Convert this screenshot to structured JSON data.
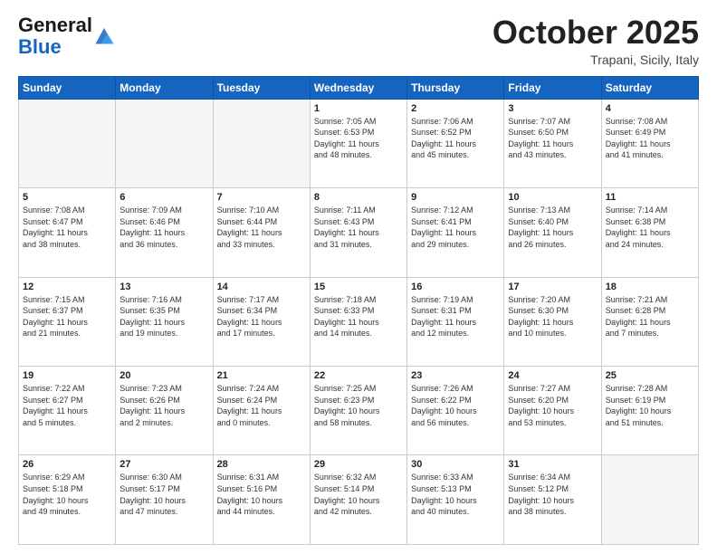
{
  "header": {
    "logo_general": "General",
    "logo_blue": "Blue",
    "month": "October 2025",
    "location": "Trapani, Sicily, Italy"
  },
  "days_of_week": [
    "Sunday",
    "Monday",
    "Tuesday",
    "Wednesday",
    "Thursday",
    "Friday",
    "Saturday"
  ],
  "weeks": [
    [
      {
        "day": "",
        "info": ""
      },
      {
        "day": "",
        "info": ""
      },
      {
        "day": "",
        "info": ""
      },
      {
        "day": "1",
        "info": "Sunrise: 7:05 AM\nSunset: 6:53 PM\nDaylight: 11 hours\nand 48 minutes."
      },
      {
        "day": "2",
        "info": "Sunrise: 7:06 AM\nSunset: 6:52 PM\nDaylight: 11 hours\nand 45 minutes."
      },
      {
        "day": "3",
        "info": "Sunrise: 7:07 AM\nSunset: 6:50 PM\nDaylight: 11 hours\nand 43 minutes."
      },
      {
        "day": "4",
        "info": "Sunrise: 7:08 AM\nSunset: 6:49 PM\nDaylight: 11 hours\nand 41 minutes."
      }
    ],
    [
      {
        "day": "5",
        "info": "Sunrise: 7:08 AM\nSunset: 6:47 PM\nDaylight: 11 hours\nand 38 minutes."
      },
      {
        "day": "6",
        "info": "Sunrise: 7:09 AM\nSunset: 6:46 PM\nDaylight: 11 hours\nand 36 minutes."
      },
      {
        "day": "7",
        "info": "Sunrise: 7:10 AM\nSunset: 6:44 PM\nDaylight: 11 hours\nand 33 minutes."
      },
      {
        "day": "8",
        "info": "Sunrise: 7:11 AM\nSunset: 6:43 PM\nDaylight: 11 hours\nand 31 minutes."
      },
      {
        "day": "9",
        "info": "Sunrise: 7:12 AM\nSunset: 6:41 PM\nDaylight: 11 hours\nand 29 minutes."
      },
      {
        "day": "10",
        "info": "Sunrise: 7:13 AM\nSunset: 6:40 PM\nDaylight: 11 hours\nand 26 minutes."
      },
      {
        "day": "11",
        "info": "Sunrise: 7:14 AM\nSunset: 6:38 PM\nDaylight: 11 hours\nand 24 minutes."
      }
    ],
    [
      {
        "day": "12",
        "info": "Sunrise: 7:15 AM\nSunset: 6:37 PM\nDaylight: 11 hours\nand 21 minutes."
      },
      {
        "day": "13",
        "info": "Sunrise: 7:16 AM\nSunset: 6:35 PM\nDaylight: 11 hours\nand 19 minutes."
      },
      {
        "day": "14",
        "info": "Sunrise: 7:17 AM\nSunset: 6:34 PM\nDaylight: 11 hours\nand 17 minutes."
      },
      {
        "day": "15",
        "info": "Sunrise: 7:18 AM\nSunset: 6:33 PM\nDaylight: 11 hours\nand 14 minutes."
      },
      {
        "day": "16",
        "info": "Sunrise: 7:19 AM\nSunset: 6:31 PM\nDaylight: 11 hours\nand 12 minutes."
      },
      {
        "day": "17",
        "info": "Sunrise: 7:20 AM\nSunset: 6:30 PM\nDaylight: 11 hours\nand 10 minutes."
      },
      {
        "day": "18",
        "info": "Sunrise: 7:21 AM\nSunset: 6:28 PM\nDaylight: 11 hours\nand 7 minutes."
      }
    ],
    [
      {
        "day": "19",
        "info": "Sunrise: 7:22 AM\nSunset: 6:27 PM\nDaylight: 11 hours\nand 5 minutes."
      },
      {
        "day": "20",
        "info": "Sunrise: 7:23 AM\nSunset: 6:26 PM\nDaylight: 11 hours\nand 2 minutes."
      },
      {
        "day": "21",
        "info": "Sunrise: 7:24 AM\nSunset: 6:24 PM\nDaylight: 11 hours\nand 0 minutes."
      },
      {
        "day": "22",
        "info": "Sunrise: 7:25 AM\nSunset: 6:23 PM\nDaylight: 10 hours\nand 58 minutes."
      },
      {
        "day": "23",
        "info": "Sunrise: 7:26 AM\nSunset: 6:22 PM\nDaylight: 10 hours\nand 56 minutes."
      },
      {
        "day": "24",
        "info": "Sunrise: 7:27 AM\nSunset: 6:20 PM\nDaylight: 10 hours\nand 53 minutes."
      },
      {
        "day": "25",
        "info": "Sunrise: 7:28 AM\nSunset: 6:19 PM\nDaylight: 10 hours\nand 51 minutes."
      }
    ],
    [
      {
        "day": "26",
        "info": "Sunrise: 6:29 AM\nSunset: 5:18 PM\nDaylight: 10 hours\nand 49 minutes."
      },
      {
        "day": "27",
        "info": "Sunrise: 6:30 AM\nSunset: 5:17 PM\nDaylight: 10 hours\nand 47 minutes."
      },
      {
        "day": "28",
        "info": "Sunrise: 6:31 AM\nSunset: 5:16 PM\nDaylight: 10 hours\nand 44 minutes."
      },
      {
        "day": "29",
        "info": "Sunrise: 6:32 AM\nSunset: 5:14 PM\nDaylight: 10 hours\nand 42 minutes."
      },
      {
        "day": "30",
        "info": "Sunrise: 6:33 AM\nSunset: 5:13 PM\nDaylight: 10 hours\nand 40 minutes."
      },
      {
        "day": "31",
        "info": "Sunrise: 6:34 AM\nSunset: 5:12 PM\nDaylight: 10 hours\nand 38 minutes."
      },
      {
        "day": "",
        "info": ""
      }
    ]
  ]
}
